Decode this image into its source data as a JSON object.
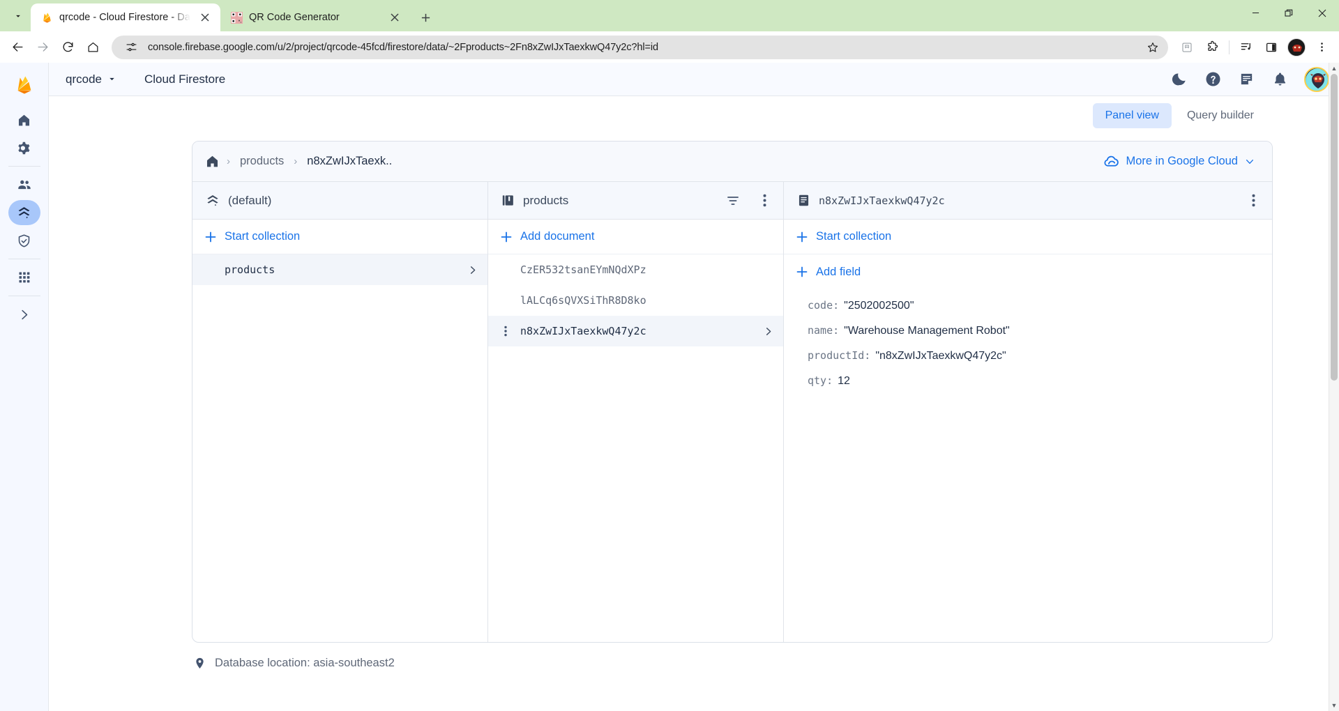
{
  "browser": {
    "tab_search_icon": "chevron-down-icon",
    "tabs": [
      {
        "title": "qrcode - Cloud Firestore - Data",
        "favicon": "firebase-icon",
        "active": true
      },
      {
        "title": "QR Code Generator",
        "favicon": "qrcode-icon",
        "active": false
      }
    ],
    "new_tab_label": "+",
    "window_controls": {
      "minimize": "minimize-icon",
      "restore": "restore-icon",
      "close": "close-icon"
    },
    "nav": {
      "back": "back-arrow-icon",
      "forward": "forward-arrow-icon",
      "reload": "reload-icon",
      "home": "home-icon"
    },
    "omnibox": {
      "site_info_icon": "tune-icon",
      "url": "console.firebase.google.com/u/2/project/qrcode-45fcd/firestore/data/~2Fproducts~2Fn8xZwIJxTaexkwQ47y2c?hl=id",
      "bookmark_icon": "star-icon"
    },
    "toolbar_icons": [
      "reading-list-icon",
      "extensions-puzzle-icon",
      "media-controls-icon",
      "side-panel-icon",
      "profile-avatar-icon",
      "chrome-menu-icon"
    ]
  },
  "firebase": {
    "rail": {
      "logo": "firebase-logo-icon",
      "items": [
        {
          "name": "project-overview",
          "icon": "home-icon",
          "active": false
        },
        {
          "name": "project-settings",
          "icon": "gear-icon",
          "active": false
        },
        {
          "name": "authentication",
          "icon": "people-icon",
          "active": false
        },
        {
          "name": "firestore-database",
          "icon": "firestore-icon",
          "active": true
        },
        {
          "name": "app-check",
          "icon": "shield-check-icon",
          "active": false
        },
        {
          "name": "all-products",
          "icon": "grid-apps-icon",
          "active": false
        },
        {
          "name": "expand-nav",
          "icon": "chevron-right-icon",
          "active": false
        }
      ]
    },
    "topbar": {
      "project": "qrcode",
      "project_dropdown_icon": "chevron-down-icon",
      "product": "Cloud Firestore",
      "icons": [
        {
          "name": "dark-mode-toggle",
          "icon": "moon-icon"
        },
        {
          "name": "help-button",
          "icon": "help-circle-icon"
        },
        {
          "name": "feedback-button",
          "icon": "note-icon"
        },
        {
          "name": "notifications-button",
          "icon": "bell-icon"
        }
      ],
      "avatar": "user-avatar"
    },
    "view_tabs": [
      {
        "label": "Panel view",
        "active": true
      },
      {
        "label": "Query builder",
        "active": false
      }
    ],
    "breadcrumb": {
      "home_icon": "home-icon",
      "separator": "›",
      "items": [
        "products",
        "n8xZwIJxTaexk.."
      ]
    },
    "more_in_google_cloud": {
      "icon": "cloud-icon",
      "label": "More in Google Cloud",
      "chevron": "chevron-down-icon"
    },
    "panel_database": {
      "icon": "firestore-icon",
      "title": "(default)",
      "action": {
        "icon": "plus-icon",
        "label": "Start collection"
      },
      "items": [
        {
          "label": "products",
          "selected": true,
          "has_chevron": true
        }
      ]
    },
    "panel_collection": {
      "icon": "collection-icon",
      "title": "products",
      "filter_icon": "filter-icon",
      "menu_icon": "kebab-menu-icon",
      "action": {
        "icon": "plus-icon",
        "label": "Add document"
      },
      "items": [
        {
          "label": "CzER532tsanEYmNQdXPz",
          "selected": false,
          "has_chevron": false
        },
        {
          "label": "lALCq6sQVXSiThR8D8ko",
          "selected": false,
          "has_chevron": false
        },
        {
          "label": "n8xZwIJxTaexkwQ47y2c",
          "selected": true,
          "has_chevron": true
        }
      ]
    },
    "panel_document": {
      "icon": "document-icon",
      "title": "n8xZwIJxTaexkwQ47y2c",
      "menu_icon": "kebab-menu-icon",
      "action_start_collection": {
        "icon": "plus-icon",
        "label": "Start collection"
      },
      "action_add_field": {
        "icon": "plus-icon",
        "label": "Add field"
      },
      "fields": [
        {
          "key": "code:",
          "value": "\"2502002500\"",
          "type": "string"
        },
        {
          "key": "name:",
          "value": "\"Warehouse Management Robot\"",
          "type": "string"
        },
        {
          "key": "productId:",
          "value": "\"n8xZwIJxTaexkwQ47y2c\"",
          "type": "string"
        },
        {
          "key": "qty:",
          "value": "12",
          "type": "number"
        }
      ]
    },
    "footer": {
      "icon": "location-pin-icon",
      "text": "Database location: asia-southeast2"
    }
  },
  "colors": {
    "accent_blue": "#1a73e8",
    "tab_strip_green": "#cfe8c2",
    "panel_bg": "#f5f8fd",
    "rail_active": "#a8c7fa"
  }
}
